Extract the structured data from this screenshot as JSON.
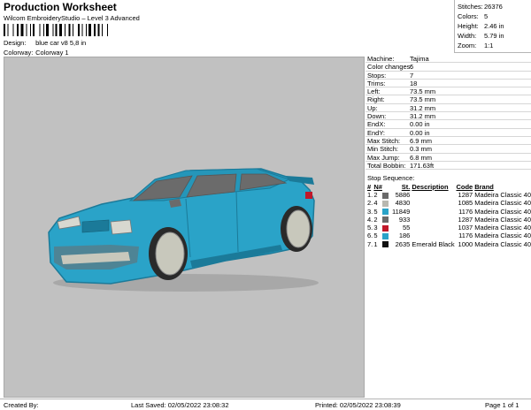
{
  "header": {
    "title": "Production Worksheet",
    "subtitle": "Wilcom EmbroideryStudio – Level 3 Advanced"
  },
  "meta": {
    "design_label": "Design:",
    "design_value": "blue car v8 5,8 in",
    "colorway_label": "Colorway:",
    "colorway_value": "Colorway 1"
  },
  "stats": [
    {
      "label": "Stitches:",
      "value": "26376"
    },
    {
      "label": "Colors:",
      "value": "5"
    },
    {
      "label": "Height:",
      "value": "2.46 in"
    },
    {
      "label": "Width:",
      "value": "5.79 in"
    },
    {
      "label": "Zoom:",
      "value": "1:1"
    }
  ],
  "machine_info": [
    {
      "label": "Machine:",
      "value": "Tajima"
    },
    {
      "label": "Color changes:",
      "value": "6"
    },
    {
      "label": "Stops:",
      "value": "7"
    },
    {
      "label": "Trims:",
      "value": "18"
    },
    {
      "label": "Left:",
      "value": "73.5 mm"
    },
    {
      "label": "Right:",
      "value": "73.5 mm"
    },
    {
      "label": "Up:",
      "value": "31.2 mm"
    },
    {
      "label": "Down:",
      "value": "31.2 mm"
    },
    {
      "label": "EndX:",
      "value": "0.00 in"
    },
    {
      "label": "EndY:",
      "value": "0.00 in"
    },
    {
      "label": "Max Stitch:",
      "value": "6.9 mm"
    },
    {
      "label": "Min Stitch:",
      "value": "0.3 mm"
    },
    {
      "label": "Max Jump:",
      "value": "6.8 mm"
    },
    {
      "label": "Total Bobbin:",
      "value": "171.63ft"
    }
  ],
  "stop_sequence": {
    "title": "Stop Sequence:",
    "headers": {
      "idx": "#",
      "n": "N#",
      "st": "St.",
      "desc": "Description",
      "code": "Code",
      "brand": "Brand"
    },
    "rows": [
      {
        "idx": "1.",
        "n": "2",
        "color": "#6b6b6b",
        "st": "5886",
        "desc": "",
        "code": "1287",
        "brand": "Madeira Classic 40"
      },
      {
        "idx": "2.",
        "n": "4",
        "color": "#b8b8b0",
        "st": "4830",
        "desc": "",
        "code": "1085",
        "brand": "Madeira Classic 40"
      },
      {
        "idx": "3.",
        "n": "5",
        "color": "#2aa3c8",
        "st": "11849",
        "desc": "",
        "code": "1176",
        "brand": "Madeira Classic 40"
      },
      {
        "idx": "4.",
        "n": "2",
        "color": "#6b6b6b",
        "st": "933",
        "desc": "",
        "code": "1287",
        "brand": "Madeira Classic 40"
      },
      {
        "idx": "5.",
        "n": "3",
        "color": "#c0182a",
        "st": "55",
        "desc": "",
        "code": "1037",
        "brand": "Madeira Classic 40"
      },
      {
        "idx": "6.",
        "n": "5",
        "color": "#2aa3c8",
        "st": "186",
        "desc": "",
        "code": "1176",
        "brand": "Madeira Classic 40"
      },
      {
        "idx": "7.",
        "n": "1",
        "color": "#101010",
        "st": "2635",
        "desc": "Emerald Black",
        "code": "1000",
        "brand": "Madeira Classic 40"
      }
    ]
  },
  "footer": {
    "created": "Created By:",
    "saved": "Last Saved: 02/05/2022 23:08:32",
    "printed": "Printed: 02/05/2022 23:08:39",
    "page": "Page 1 of 1"
  },
  "colors": {
    "canvas_bg": "#c1c1c1",
    "car_body": "#2aa3c8",
    "car_shadow": "#1b7a99",
    "window": "#6b6b6b",
    "wheel": "#c8c8bc",
    "tail_light": "#c0182a"
  }
}
